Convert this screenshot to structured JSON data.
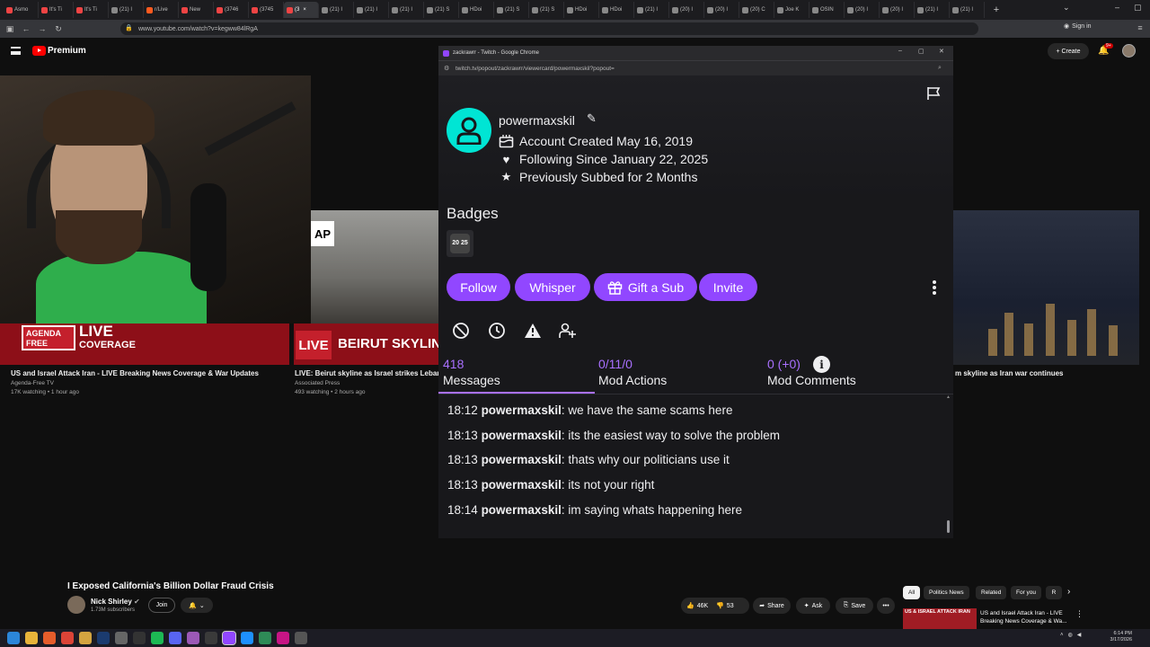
{
  "browser": {
    "tabs": [
      {
        "label": "Asmo",
        "color": "#e44"
      },
      {
        "label": "It's Ti",
        "color": "#e44"
      },
      {
        "label": "It's Ti",
        "color": "#e44"
      },
      {
        "label": "(21) I",
        "color": "#888"
      },
      {
        "label": "r/Live",
        "color": "#ff5a1f"
      },
      {
        "label": "New",
        "color": "#e44"
      },
      {
        "label": "(3746",
        "color": "#e44"
      },
      {
        "label": "(3745",
        "color": "#e44"
      },
      {
        "label": "(3",
        "color": "#e44",
        "active": true
      },
      {
        "label": "(21) I",
        "color": "#888"
      },
      {
        "label": "(21) I",
        "color": "#888"
      },
      {
        "label": "(21) I",
        "color": "#888"
      },
      {
        "label": "(21) S",
        "color": "#888"
      },
      {
        "label": "HDoi",
        "color": "#888"
      },
      {
        "label": "(21) S",
        "color": "#888"
      },
      {
        "label": "(21) S",
        "color": "#888"
      },
      {
        "label": "HDoi",
        "color": "#888"
      },
      {
        "label": "HDoi",
        "color": "#888"
      },
      {
        "label": "(21) I",
        "color": "#888"
      },
      {
        "label": "(20) I",
        "color": "#888"
      },
      {
        "label": "(20) I",
        "color": "#888"
      },
      {
        "label": "(20) C",
        "color": "#888"
      },
      {
        "label": "Joe K",
        "color": "#888"
      },
      {
        "label": "OSIN",
        "color": "#888"
      },
      {
        "label": "(20) I",
        "color": "#888"
      },
      {
        "label": "(20) I",
        "color": "#888"
      },
      {
        "label": "(21) I",
        "color": "#888"
      },
      {
        "label": "(21) I",
        "color": "#888"
      }
    ],
    "tab_close": "×",
    "new_tab": "+",
    "url": "www.youtube.com/watch?v=kegww84lRgA",
    "sign_in": "Sign in",
    "nav": {
      "back": "←",
      "forward": "→",
      "reload": "↻"
    }
  },
  "youtube": {
    "brand": "Premium",
    "create": "+ Create",
    "notif_count": "9+",
    "videos": [
      {
        "title": "US and Israel Attack Iran - LIVE Breaking News Coverage & War Updates",
        "channel": "Agenda-Free TV",
        "meta": "17K watching • 1 hour ago",
        "thumb_label_1": "AGENDA FREE",
        "thumb_label_2": "LIVE",
        "thumb_label_3": "COVERAGE"
      },
      {
        "title": "LIVE: Beirut skyline as Israel strikes Lebanon",
        "channel": "Associated Press",
        "meta": "493 watching • 2 hours ago",
        "thumb_label": "LIVE",
        "thumb_label_2": "BEIRUT SKYLIN",
        "logo": "AP"
      },
      {
        "title": "m skyline as Iran war continues"
      }
    ],
    "main_video": {
      "title": "I Exposed California's Billion Dollar Fraud Crisis",
      "channel": "Nick Shirley",
      "subscribers": "1.73M subscribers",
      "join": "Join",
      "likes": "46K",
      "dislikes": "53",
      "share": "Share",
      "ask": "Ask",
      "save": "Save",
      "more": "•••"
    },
    "chips": [
      "All",
      "Politics News",
      "Related",
      "For you",
      "R"
    ],
    "side_video": {
      "title": "US and Israel Attack Iran - LIVE Breaking News Coverage & Wa...",
      "thumb_label": "US & ISRAEL ATTACK IRAN"
    }
  },
  "popup": {
    "window_title": "zackrawrr - Twitch - Google Chrome",
    "url": "twitch.tv/popout/zackrawrr/viewercard/powermaxskil?popout=",
    "username": "powermaxskil",
    "account_created": "Account Created May 16, 2019",
    "following_since": "Following Since January 22, 2025",
    "subbed": "Previously Subbed for 2 Months",
    "badges_heading": "Badges",
    "badge_text": "20 25",
    "buttons": {
      "follow": "Follow",
      "whisper": "Whisper",
      "gift": "Gift a Sub",
      "invite": "Invite"
    },
    "stats": [
      {
        "value": "418",
        "label": "Messages"
      },
      {
        "value": "0/11/0",
        "label": "Mod Actions"
      },
      {
        "value": "0 (+0)",
        "label": "Mod Comments"
      }
    ],
    "info_glyph": "i",
    "messages": [
      {
        "time": "18:12",
        "user": "powermaxskil",
        "text": ": we have the same scams here"
      },
      {
        "time": "18:13",
        "user": "powermaxskil",
        "text": ": its the easiest way to solve the problem"
      },
      {
        "time": "18:13",
        "user": "powermaxskil",
        "text": ": thats why our politicians use it"
      },
      {
        "time": "18:13",
        "user": "powermaxskil",
        "text": ": its not your right"
      },
      {
        "time": "18:14",
        "user": "powermaxskil",
        "text": ": im saying whats happening here"
      }
    ],
    "accent": "#9147ff"
  },
  "taskbar": {
    "time": "6:14 PM",
    "date": "3/17/2026"
  }
}
